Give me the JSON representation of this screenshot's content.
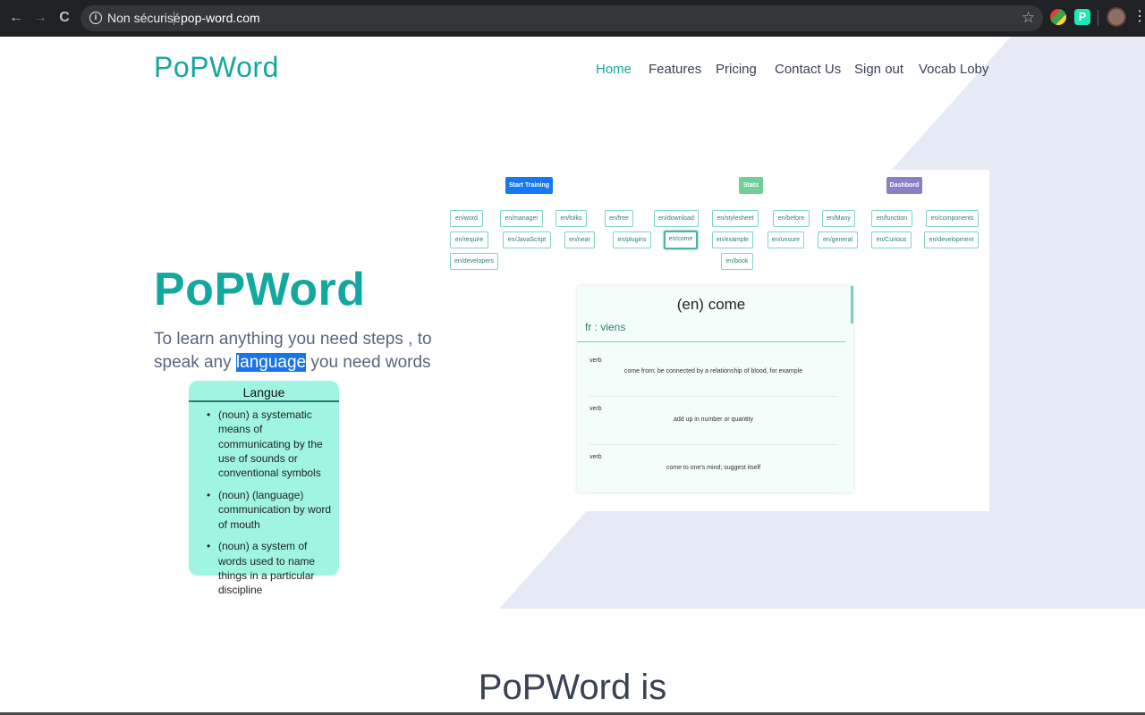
{
  "browser": {
    "security_label": "Non sécurisé",
    "url": "pop-word.com",
    "back_glyph": "←",
    "forward_glyph": "→",
    "reload_glyph": "C",
    "info_glyph": "i",
    "star_glyph": "☆",
    "kebab_glyph": "⋮"
  },
  "site": {
    "logo": "PoPWord",
    "nav": [
      "Home",
      "Features",
      "Pricing",
      "Contact Us",
      "Sign out",
      "Vocab Loby"
    ],
    "accent": "#13a89e",
    "shape_color": "#e6eaf4"
  },
  "hero": {
    "title": "PoPWord",
    "sub_before": "To learn anything you need steps , to speak any ",
    "sub_highlight": "language",
    "sub_after": " you need words"
  },
  "popup": {
    "title": "Langue",
    "items": [
      "(noun) a systematic means of communicating by the use of sounds or conventional symbols",
      "(noun) (language) communication by word of mouth",
      "(noun) a system of words used to name things in a particular discipline"
    ]
  },
  "app": {
    "buttons": {
      "start": "Start Training",
      "stats": "Stats",
      "dashboard": "Dashbord",
      "start_color": "#1877f2",
      "stats_color": "#6fcf97",
      "dashboard_color": "#8a7fc5"
    },
    "tags": [
      "en/word",
      "en/manager",
      "en/folks",
      "en/free",
      "en/download",
      "en/stylesheet",
      "en/before",
      "en/Many",
      "en/function",
      "en/components",
      "en/require",
      "en/JavaScript",
      "en/near",
      "en/plugins",
      "en/come",
      "en/example",
      "en/unsure",
      "en/general",
      "en/Curious",
      "en/development",
      "en/developers",
      "en/book"
    ],
    "selected_tag": "en/come",
    "card": {
      "title": "(en) come",
      "translation": "fr : viens",
      "definitions": [
        {
          "pos": "verb",
          "text": "come from; be connected by a relationship of blood, for example"
        },
        {
          "pos": "verb",
          "text": "add up in number or quantity"
        },
        {
          "pos": "verb",
          "text": "come to one's mind; suggest itself"
        }
      ]
    }
  },
  "section": {
    "title": "PoPWord is"
  }
}
